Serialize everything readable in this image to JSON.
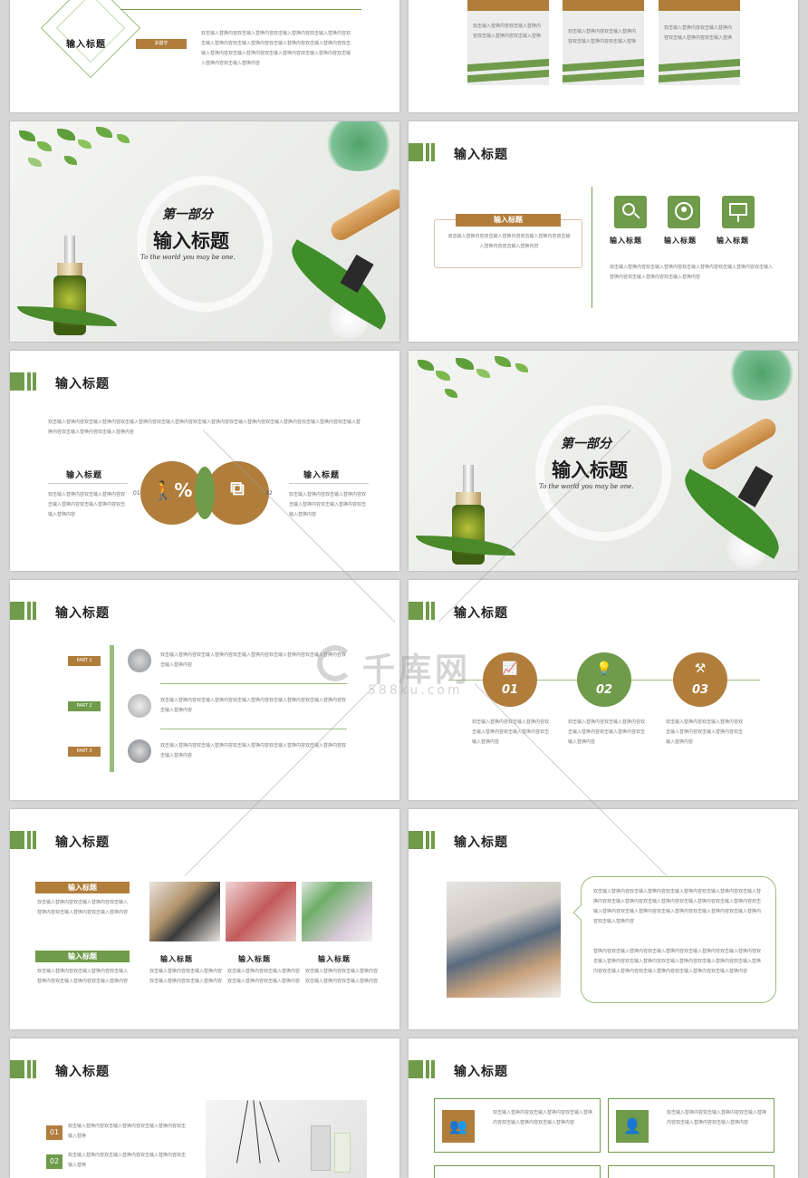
{
  "placeholder_text": "双击输入替换内容双击输入替换内容双击输入替换内容双击输入替换内容",
  "placeholder_short": "双击输入替换内容双击输入替换内容双击输入",
  "slide1": {
    "title": "输入标题",
    "keyword": "关键字",
    "body": "双击输入替换内容双击输入替换内容双击输入替换内容双击输入替换内容双击输入替换内容双击输入替换内容双击输入替换内容双击输入替换内容双击输入替换内容双击输入替换内容双击输入替换内容双击输入替换内容双击输入替换内容双击输入替换内容"
  },
  "slide2": {
    "cards": [
      "双击输入替换内容双击输入替换内容双击输入替换内容双击输入替换",
      "双击输入替换内容双击输入替换内容双击输入替换内容双击输入替换",
      "双击输入替换内容双击输入替换内容双击输入替换内容双击输入替换"
    ]
  },
  "cover": {
    "part": "第一部分",
    "title": "输入标题",
    "subtitle": "To the world you may be one."
  },
  "slide4": {
    "title": "输入标题",
    "label": "输入标题",
    "body": "双击输入替换内容双击输入替换内容双击输入替换内容双击输入替换内容双击输入替换内容",
    "icons": [
      {
        "icon": "search-chart-icon",
        "label": "输入标题"
      },
      {
        "icon": "team-icon",
        "label": "输入标题"
      },
      {
        "icon": "presentation-icon",
        "label": "输入标题"
      }
    ],
    "desc": "双击输入替换内容双击输入替换内容双击输入替换内容双击输入替换内容双击输入替换内容双击输入替换内容双击输入替换内容"
  },
  "slide5": {
    "title": "输入标题",
    "intro": "双击输入替换内容双击输入替换内容双击输入替换内容双击输入替换内容双击输入替换内容双击输入替换内容双击输入替换内容双击输入替换内容双击输入替换内容双击输入替换内容双击输入替换内容",
    "left": {
      "heading": "输入标题",
      "body": "双击输入替换内容双击输入替换内容双击输入替换内容双击输入替换内容双击输入替换内容"
    },
    "right": {
      "heading": "输入标题",
      "body": "双击输入替换内容双击输入替换内容双击输入替换内容双击输入替换内容双击输入替换内容"
    },
    "num1": "01",
    "num2": "02"
  },
  "slide7": {
    "title": "输入标题",
    "parts": [
      {
        "label": "PART 1",
        "text": "双击输入替换内容双击输入替换内容双击输入替换内容双击输入替换内容双击输入替换内容双击输入替换内容"
      },
      {
        "label": "PART 2",
        "text": "双击输入替换内容双击输入替换内容双击输入替换内容双击输入替换内容双击输入替换内容双击输入替换内容"
      },
      {
        "label": "PART 3",
        "text": "双击输入替换内容双击输入替换内容双击输入替换内容双击输入替换内容双击输入替换内容双击输入替换内容"
      }
    ]
  },
  "slide8": {
    "title": "输入标题",
    "steps": [
      {
        "num": "01",
        "text": "双击输入替换内容双击输入替换内容双击输入替换内容双击输入替换内容双击输入替换内容"
      },
      {
        "num": "02",
        "text": "双击输入替换内容双击输入替换内容双击输入替换内容双击输入替换内容双击输入替换内容"
      },
      {
        "num": "03",
        "text": "双击输入替换内容双击输入替换内容双击输入替换内容双击输入替换内容双击输入替换内容"
      }
    ]
  },
  "slide9": {
    "title": "输入标题",
    "blocks": [
      {
        "label": "输入标题",
        "text": "双击输入替换内容双击输入替换内容双击输入替换内容双击输入替换内容双击输入替换内容"
      },
      {
        "label": "输入标题",
        "text": "双击输入替换内容双击输入替换内容双击输入替换内容双击输入替换内容双击输入替换内容"
      }
    ],
    "photos": [
      {
        "heading": "输入标题",
        "text": "双击输入替换内容双击输入替换内容双击输入替换内容双击输入替换内容"
      },
      {
        "heading": "输入标题",
        "text": "双击输入替换内容双击输入替换内容双击输入替换内容双击输入替换内容"
      },
      {
        "heading": "输入标题",
        "text": "双击输入替换内容双击输入替换内容双击输入替换内容双击输入替换内容"
      }
    ]
  },
  "slide10": {
    "title": "输入标题",
    "para1": "双击输入替换内容双击输入替换内容双击输入替换内容双击输入替换内容双击输入替换内容双击输入替换内容双击输入替换内容双击输入替换内容双击输入替换内容双击输入替换内容双击输入替换内容双击输入替换内容双击输入替换内容双击输入替换内容双击输入替换内容",
    "para2": "替换内容双击输入替换内容双击输入替换内容双击输入替换内容双击输入替换内容双击输入替换内容双击输入替换内容双击输入替换内容双击输入替换内容双击输入替换内容双击输入替换内容双击输入替换内容双击输入替换内容双击输入替换内容"
  },
  "slide11": {
    "title": "输入标题",
    "items": [
      {
        "num": "01",
        "text": "双击输入替换内容双击输入替换内容双击输入替换内容双击输入替换"
      },
      {
        "num": "02",
        "text": "双击输入替换内容双击输入替换内容双击输入替换内容双击输入替换"
      }
    ]
  },
  "slide12": {
    "title": "输入标题",
    "boxes": [
      {
        "icon": "group-icon",
        "text": "双击输入替换内容双击输入替换内容双击输入替换内容双击输入替换内容双击输入替换内容"
      },
      {
        "icon": "user-icon",
        "text": "双击输入替换内容双击输入替换内容双击输入替换内容双击输入替换内容双击输入替换内容"
      }
    ]
  },
  "watermark": {
    "brand": "千库网",
    "url": "588ku.com"
  },
  "colors": {
    "green": "#6f9b4a",
    "brown": "#b07d3b",
    "dark": "#222222"
  }
}
